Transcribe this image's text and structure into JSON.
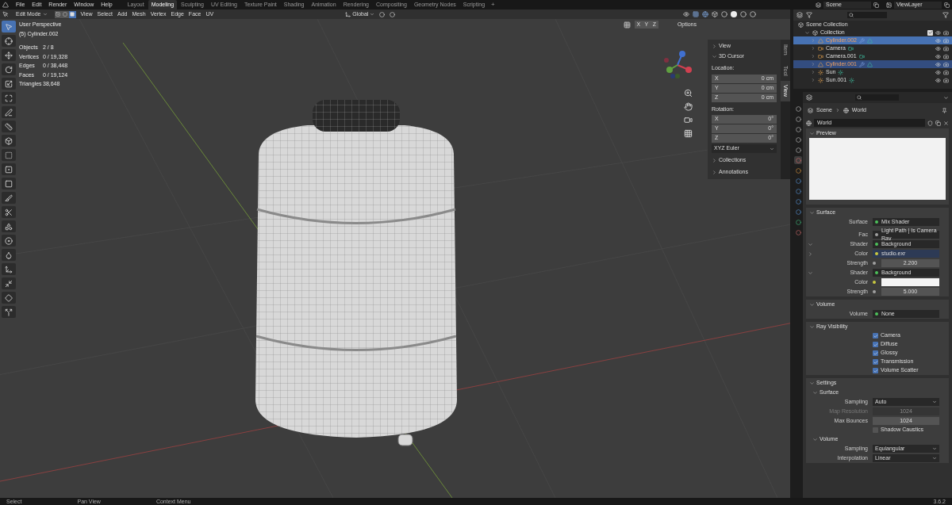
{
  "menu": [
    "File",
    "Edit",
    "Render",
    "Window",
    "Help"
  ],
  "workspaces": [
    {
      "label": "Layout",
      "selected": false
    },
    {
      "label": "Modeling",
      "selected": true
    },
    {
      "label": "Sculpting",
      "selected": false
    },
    {
      "label": "UV Editing",
      "selected": false
    },
    {
      "label": "Texture Paint",
      "selected": false
    },
    {
      "label": "Shading",
      "selected": false
    },
    {
      "label": "Animation",
      "selected": false
    },
    {
      "label": "Rendering",
      "selected": false
    },
    {
      "label": "Compositing",
      "selected": false
    },
    {
      "label": "Geometry Nodes",
      "selected": false
    },
    {
      "label": "Scripting",
      "selected": false
    }
  ],
  "add_workspace": "+",
  "scene": "Scene",
  "view_layer": "ViewLayer",
  "header": {
    "mode": "Edit Mode",
    "select_modes": [
      {
        "kind": "vertex",
        "selected": false
      },
      {
        "kind": "edge",
        "selected": false
      },
      {
        "kind": "face",
        "selected": true
      }
    ],
    "menus": [
      "View",
      "Select",
      "Add",
      "Mesh",
      "Vertex",
      "Edge",
      "Face",
      "UV"
    ],
    "orientation": "Global",
    "axes": [
      "X",
      "Y",
      "Z"
    ],
    "options": "Options"
  },
  "overlay": {
    "view": "User Perspective",
    "object": "(5) Cylinder.002",
    "stats": [
      [
        "Objects",
        "2 / 8"
      ],
      [
        "Vertices",
        "0 / 19,328"
      ],
      [
        "Edges",
        "0 / 38,448"
      ],
      [
        "Faces",
        "0 / 19,124"
      ],
      [
        "Triangles",
        "38,648"
      ]
    ]
  },
  "tools": [
    {
      "kind": "select",
      "selected": true
    },
    {
      "kind": "cursor",
      "selected": false
    },
    {
      "kind": "move",
      "selected": false
    },
    {
      "kind": "rotate",
      "selected": false
    },
    {
      "kind": "scale",
      "selected": false
    },
    {
      "kind": "transform",
      "selected": false
    },
    {
      "kind": "annotate",
      "selected": false
    },
    {
      "kind": "measure",
      "selected": false
    },
    {
      "kind": "add",
      "selected": false
    },
    {
      "kind": "extrude",
      "selected": false
    },
    {
      "kind": "inset",
      "selected": false
    },
    {
      "kind": "bevel",
      "selected": false
    },
    {
      "kind": "loopcut",
      "selected": false
    },
    {
      "kind": "knife",
      "selected": false
    },
    {
      "kind": "polybuild",
      "selected": false
    },
    {
      "kind": "spin",
      "selected": false
    },
    {
      "kind": "smooth",
      "selected": false
    },
    {
      "kind": "slide",
      "selected": false
    },
    {
      "kind": "shrink",
      "selected": false
    },
    {
      "kind": "shear",
      "selected": false
    },
    {
      "kind": "rip",
      "selected": false
    }
  ],
  "sidebar": {
    "tabs": [
      {
        "label": "Item",
        "selected": false
      },
      {
        "label": "Tool",
        "selected": false
      },
      {
        "label": "View",
        "selected": true
      }
    ],
    "view": {
      "label": "View",
      "expanded": false
    },
    "cursor": {
      "label": "3D Cursor",
      "expanded": true,
      "location_label": "Location:",
      "location": [
        [
          "X",
          "0 cm"
        ],
        [
          "Y",
          "0 cm"
        ],
        [
          "Z",
          "0 cm"
        ]
      ],
      "rotation_label": "Rotation:",
      "rotation": [
        [
          "X",
          "0°"
        ],
        [
          "Y",
          "0°"
        ],
        [
          "Z",
          "0°"
        ]
      ],
      "mode": "XYZ Euler"
    },
    "collapsed": [
      {
        "label": "Collections",
        "expanded": false
      },
      {
        "label": "Annotations",
        "expanded": false
      }
    ]
  },
  "outliner": {
    "root": "Scene Collection",
    "collection": {
      "label": "Collection",
      "checked": true,
      "expanded": true
    },
    "items": [
      {
        "label": "Cylinder.002",
        "kind": "mesh",
        "selected": true,
        "active": true,
        "modifier": true
      },
      {
        "label": "Camera",
        "kind": "camera",
        "selected": false,
        "active": false,
        "modifier": false
      },
      {
        "label": "Camera.001",
        "kind": "camera",
        "selected": false,
        "active": false,
        "modifier": false
      },
      {
        "label": "Cylinder.001",
        "kind": "mesh",
        "selected": true,
        "active": false,
        "modifier": true
      },
      {
        "label": "Sun",
        "kind": "light",
        "selected": false,
        "active": false,
        "modifier": false
      },
      {
        "label": "Sun.001",
        "kind": "light",
        "selected": false,
        "active": false,
        "modifier": false
      }
    ]
  },
  "properties": {
    "tabs": [
      {
        "kind": "tool",
        "selected": false
      },
      {
        "kind": "render",
        "selected": false
      },
      {
        "kind": "output",
        "selected": false
      },
      {
        "kind": "view_layer",
        "selected": false
      },
      {
        "kind": "scene",
        "selected": false
      },
      {
        "kind": "world",
        "selected": true
      },
      {
        "kind": "object",
        "selected": false
      },
      {
        "kind": "modifiers",
        "selected": false
      },
      {
        "kind": "particles",
        "selected": false
      },
      {
        "kind": "physics",
        "selected": false
      },
      {
        "kind": "constraints",
        "selected": false
      },
      {
        "kind": "data",
        "selected": false
      },
      {
        "kind": "material",
        "selected": false
      }
    ],
    "breadcrumb": [
      "Scene",
      "World"
    ],
    "datablock": "World",
    "preview": {
      "label": "Preview",
      "expanded": true
    },
    "surface": {
      "label": "Surface",
      "expanded": true,
      "rows": [
        {
          "kind": "socket",
          "socket": {
            "kind": "shader"
          },
          "label": "Surface",
          "value": "Mix Shader"
        },
        {
          "kind": "socket",
          "socket": {
            "kind": "float"
          },
          "label": "Fac",
          "value": "Light Path | Is Camera Ray"
        },
        {
          "kind": "socket",
          "socket": {
            "kind": "shader"
          },
          "label": "Shader",
          "value": "Background",
          "expanded": true
        },
        {
          "kind": "socket",
          "socket": {
            "kind": "color"
          },
          "label": "Color",
          "value": "studio.exr",
          "expanded": false,
          "highlight": true
        },
        {
          "kind": "number",
          "socket": {
            "kind": "float"
          },
          "label": "Strength",
          "value": "2.200"
        },
        {
          "kind": "socket",
          "socket": {
            "kind": "shader"
          },
          "label": "Shader",
          "value": "Background",
          "expanded": true
        },
        {
          "kind": "swatch",
          "socket": {
            "kind": "color"
          },
          "label": "Color",
          "color": "#f4f4f4"
        },
        {
          "kind": "number",
          "socket": {
            "kind": "float"
          },
          "label": "Strength",
          "value": "5.000"
        }
      ]
    },
    "volume": {
      "label": "Volume",
      "expanded": true,
      "row": {
        "socket": {
          "kind": "shader"
        },
        "label": "Volume",
        "value": "None"
      }
    },
    "ray_visibility": {
      "label": "Ray Visibility",
      "expanded": true,
      "items": [
        {
          "label": "Camera",
          "checked": true
        },
        {
          "label": "Diffuse",
          "checked": true
        },
        {
          "label": "Glossy",
          "checked": true
        },
        {
          "label": "Transmission",
          "checked": true
        },
        {
          "label": "Volume Scatter",
          "checked": true
        }
      ]
    },
    "settings": {
      "label": "Settings",
      "expanded": true,
      "surface": {
        "label": "Surface",
        "expanded": true,
        "rows": [
          {
            "kind": "dropdown",
            "label": "Sampling",
            "value": "Auto",
            "disabled": false
          },
          {
            "kind": "number",
            "label": "Map Resolution",
            "value": "1024",
            "disabled": true
          },
          {
            "kind": "number",
            "label": "Max Bounces",
            "value": "1024",
            "disabled": false
          },
          {
            "kind": "checkbox",
            "label": "Shadow Caustics",
            "checked": false
          }
        ]
      },
      "volume": {
        "label": "Volume",
        "expanded": true,
        "rows": [
          {
            "kind": "dropdown",
            "label": "Sampling",
            "value": "Equiangular",
            "disabled": false
          },
          {
            "kind": "dropdown",
            "label": "Interpolation",
            "value": "Linear",
            "disabled": false
          }
        ]
      }
    }
  },
  "status": [
    "Select",
    "Pan View",
    "Context Menu"
  ],
  "version": "3.6.2"
}
